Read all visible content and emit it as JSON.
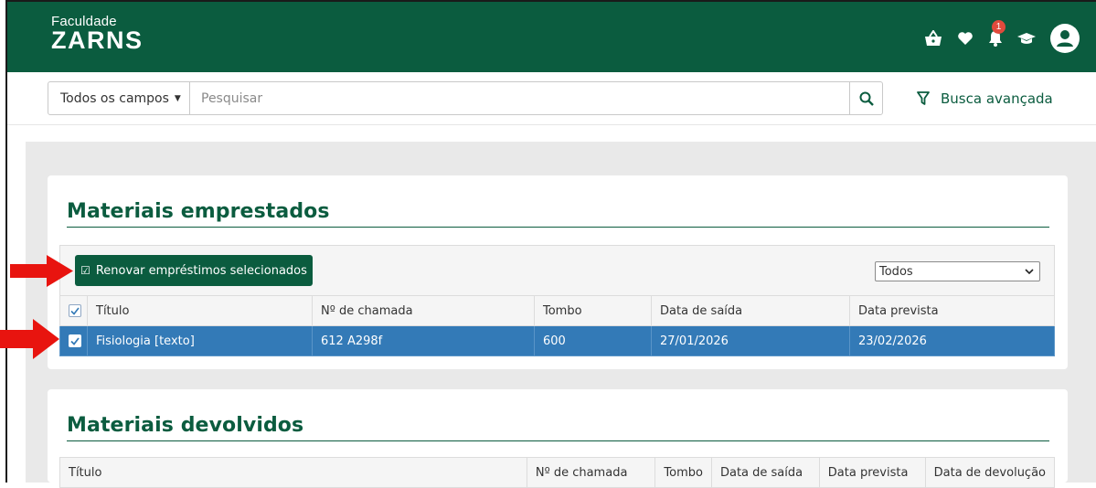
{
  "header": {
    "logo_small": "Faculdade",
    "logo_big": "ZARNS",
    "notification_count": "1",
    "icons": [
      "basket-icon",
      "heart-icon",
      "bell-icon",
      "graduation-cap-icon",
      "user-avatar-icon"
    ]
  },
  "search": {
    "field_select": "Todos os campos",
    "placeholder": "Pesquisar",
    "advanced_label": "Busca avançada"
  },
  "borrowed": {
    "title": "Materiais emprestados",
    "renew_button": "Renovar empréstimos selecionados",
    "filter_value": "Todos",
    "columns": [
      "Título",
      "Nº de chamada",
      "Tombo",
      "Data de saída",
      "Data prevista"
    ],
    "rows": [
      {
        "title": "Fisiologia [texto]",
        "call_number": "612 A298f",
        "tombo": "600",
        "checkout": "27/01/2026",
        "due": "23/02/2026",
        "selected": true
      }
    ]
  },
  "returned": {
    "title": "Materiais devolvidos",
    "columns": [
      "Título",
      "Nº de chamada",
      "Tombo",
      "Data de saída",
      "Data prevista",
      "Data de devolução"
    ]
  },
  "colors": {
    "brand_green": "#0b5c3f",
    "selection_blue": "#337ab7",
    "annotation_red": "#e8140f",
    "badge_red": "#e04a3c"
  }
}
